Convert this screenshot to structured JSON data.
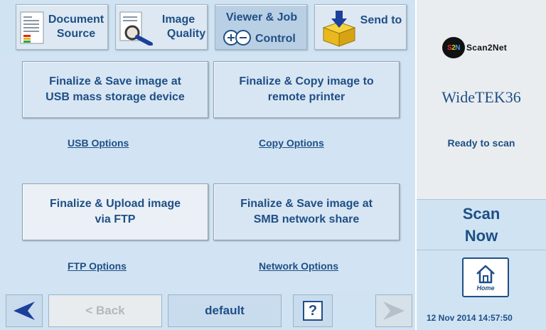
{
  "tabs": [
    {
      "id": "document-source",
      "line1": "Document",
      "line2": "Source",
      "icon": "document-icon"
    },
    {
      "id": "image-quality",
      "line1": "Image",
      "line2": "Quality",
      "icon": "magnifier-icon"
    },
    {
      "id": "viewer-job-control",
      "line1": "Viewer & Job",
      "line2": "Control",
      "icon": "zoom-plus-minus-icon",
      "active": true
    },
    {
      "id": "send-to",
      "line1": "Send to",
      "icon": "box-arrow-icon"
    }
  ],
  "actions": {
    "usb": {
      "line1": "Finalize & Save image at",
      "line2": "USB mass storage device"
    },
    "copy": {
      "line1": "Finalize & Copy image to",
      "line2": "remote printer"
    },
    "ftp": {
      "line1": "Finalize & Upload image",
      "line2": "via FTP"
    },
    "smb": {
      "line1": "Finalize & Save image at",
      "line2": "SMB network share"
    }
  },
  "options": {
    "usb": "USB Options",
    "copy": "Copy Options",
    "ftp": "FTP Options",
    "network": "Network Options"
  },
  "bottom": {
    "prev_icon": "arrow-left-icon",
    "back_label": "< Back",
    "default_label": "default",
    "help_label": "?",
    "next_icon": "arrow-right-icon"
  },
  "right_panel": {
    "logo_text": "Scan2Net",
    "logo_badge": "S2N",
    "product": "WideTEK36",
    "status": "Ready to scan",
    "scan_line1": "Scan",
    "scan_line2": "Now",
    "home_label": "Home",
    "datetime": "12 Nov 2014 14:57:50"
  },
  "colors": {
    "accent": "#1f4f86",
    "panel": "#d2e4f3",
    "background": "#e9edf0"
  }
}
